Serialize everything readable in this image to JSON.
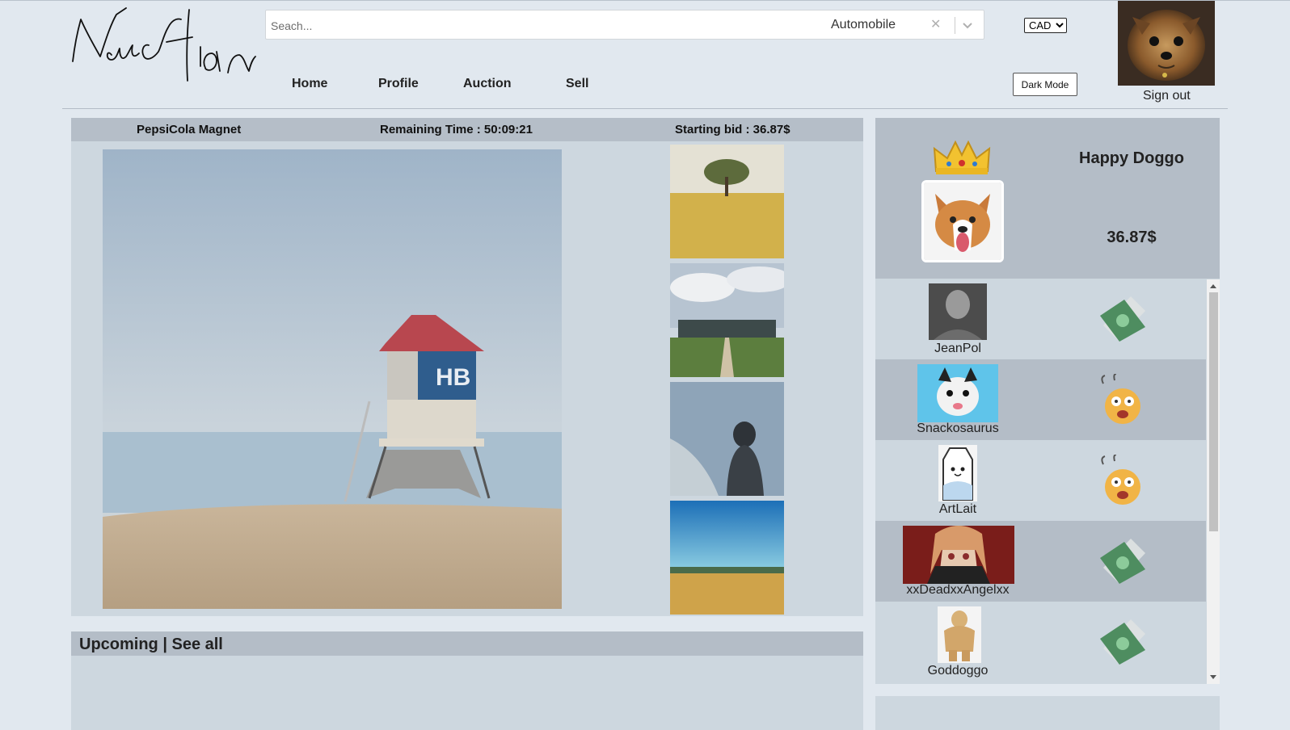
{
  "header": {
    "search": {
      "placeholder": "Seach...",
      "category": "Automobile",
      "clear_symbol": "✕"
    },
    "currency": {
      "selected": "CAD",
      "options": [
        "CAD"
      ]
    },
    "dark_mode_label": "Dark Mode",
    "sign_out_label": "Sign out"
  },
  "nav": [
    {
      "label": "Home"
    },
    {
      "label": "Profile"
    },
    {
      "label": "Auction"
    },
    {
      "label": "Sell"
    }
  ],
  "auction": {
    "item_name": "PepsiCola Magnet",
    "remaining_time": "Remaining Time : 50:09:21",
    "starting_bid": "Starting bid : 36.87$"
  },
  "upcoming": {
    "label": "Upcoming | See all"
  },
  "leader": {
    "name": "Happy Doggo",
    "bid": "36.87$"
  },
  "bidders": [
    {
      "name": "JeanPol",
      "reaction": "money-icon"
    },
    {
      "name": "Snackosaurus",
      "reaction": "shocked-face-icon"
    },
    {
      "name": "ArtLait",
      "reaction": "shocked-face-icon"
    },
    {
      "name": "xxDeadxxAngelxx",
      "reaction": "money-icon"
    },
    {
      "name": "Goddoggo",
      "reaction": "money-icon"
    }
  ],
  "colors": {
    "page_bg": "#e1e8ef",
    "panel_bg": "#cdd7df",
    "panel_header": "#b5bec8",
    "money_green": "#4a8a5e"
  }
}
